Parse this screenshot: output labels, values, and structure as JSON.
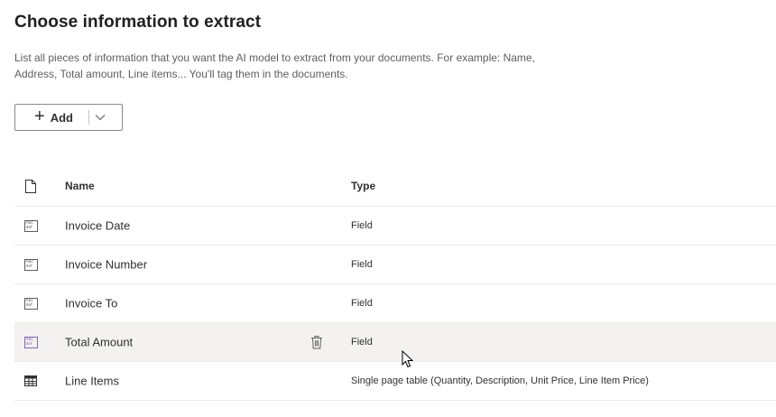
{
  "header": {
    "title": "Choose information to extract",
    "description": "List all pieces of information that you want the AI model to extract from your documents. For example: Name, Address, Total amount, Line items... You'll tag them in the documents."
  },
  "toolbar": {
    "add_label": "Add",
    "add_icon": "plus-icon",
    "dropdown_icon": "chevron-down-icon"
  },
  "table": {
    "columns": {
      "icon": "document-icon",
      "name": "Name",
      "type": "Type"
    },
    "rows": [
      {
        "name": "Invoice Date",
        "type": "Field",
        "icon": "text-field-icon",
        "selected": false
      },
      {
        "name": "Invoice Number",
        "type": "Field",
        "icon": "text-field-icon",
        "selected": false
      },
      {
        "name": "Invoice To",
        "type": "Field",
        "icon": "text-field-icon",
        "selected": false
      },
      {
        "name": "Total Amount",
        "type": "Field",
        "icon": "text-field-icon",
        "selected": true
      },
      {
        "name": "Line Items",
        "type": "Single page table (Quantity, Description, Unit Price, Line Item Price)",
        "icon": "table-icon",
        "selected": false
      }
    ]
  },
  "colors": {
    "selected_row": "#f3f2f1",
    "accent_purple": "#8764b8",
    "border": "#edebe9"
  }
}
